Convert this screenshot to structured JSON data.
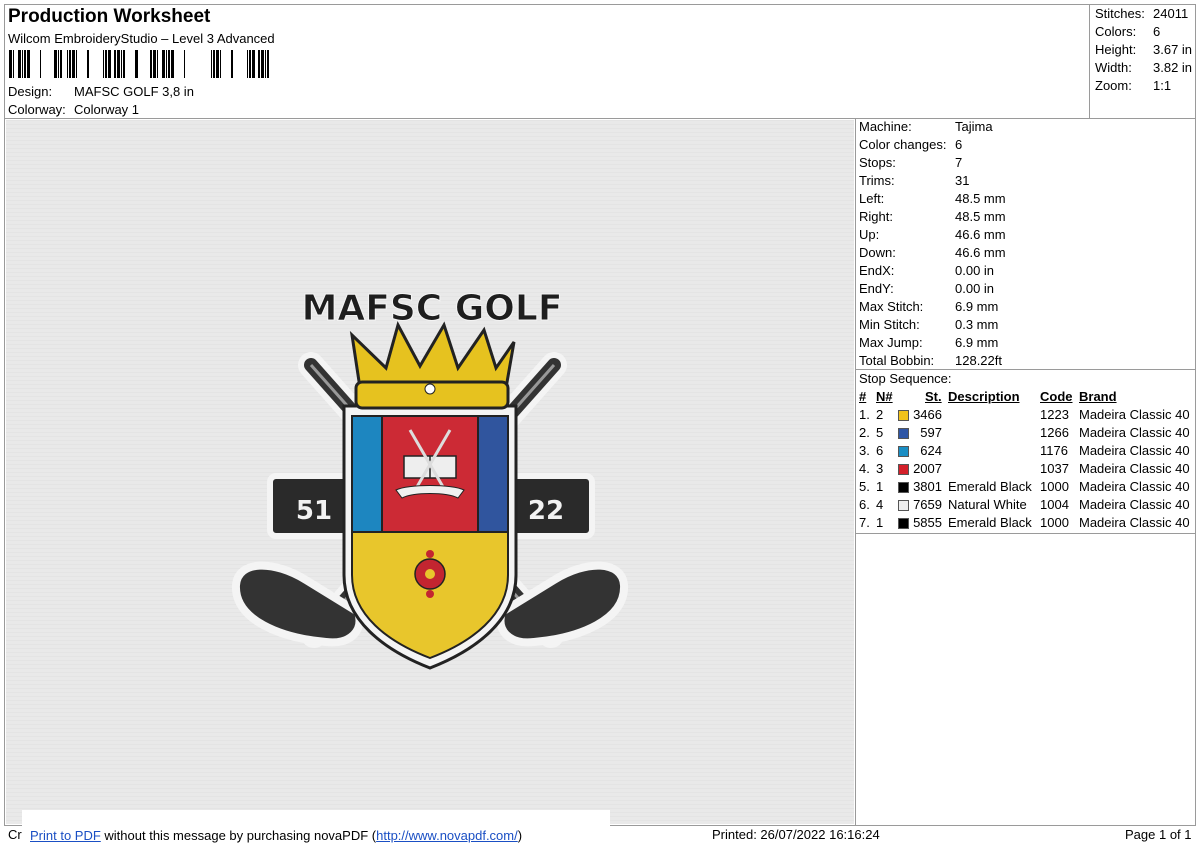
{
  "header": {
    "title": "Production Worksheet",
    "software": "Wilcom EmbroideryStudio – Level 3 Advanced",
    "design_label": "Design:",
    "design_value": "MAFSC GOLF 3,8 in",
    "colorway_label": "Colorway:",
    "colorway_value": "Colorway 1"
  },
  "summary": [
    {
      "label": "Stitches:",
      "value": "24011"
    },
    {
      "label": "Colors:",
      "value": "6"
    },
    {
      "label": "Height:",
      "value": "3.67 in"
    },
    {
      "label": "Width:",
      "value": "3.82 in"
    },
    {
      "label": "Zoom:",
      "value": "1:1"
    }
  ],
  "machine_info": [
    {
      "label": "Machine:",
      "value": "Tajima"
    },
    {
      "label": "Color changes:",
      "value": "6"
    },
    {
      "label": "Stops:",
      "value": "7"
    },
    {
      "label": "Trims:",
      "value": "31"
    },
    {
      "label": "Left:",
      "value": "48.5 mm"
    },
    {
      "label": "Right:",
      "value": "48.5 mm"
    },
    {
      "label": "Up:",
      "value": "46.6 mm"
    },
    {
      "label": "Down:",
      "value": "46.6 mm"
    },
    {
      "label": "EndX:",
      "value": "0.00 in"
    },
    {
      "label": "EndY:",
      "value": "0.00 in"
    },
    {
      "label": "Max Stitch:",
      "value": "6.9 mm"
    },
    {
      "label": "Min Stitch:",
      "value": "0.3 mm"
    },
    {
      "label": "Max Jump:",
      "value": "6.9 mm"
    },
    {
      "label": "Total Bobbin:",
      "value": "128.22ft"
    }
  ],
  "stop_sequence": {
    "title": "Stop Sequence:",
    "headers": {
      "num": "#",
      "n": "N#",
      "st": "St.",
      "desc": "Description",
      "code": "Code",
      "brand": "Brand"
    },
    "rows": [
      {
        "num": "1.",
        "n": "2",
        "color": "#f2c21b",
        "st": "3466",
        "desc": "",
        "code": "1223",
        "brand": "Madeira Classic 40"
      },
      {
        "num": "2.",
        "n": "5",
        "color": "#2f56a6",
        "st": "597",
        "desc": "",
        "code": "1266",
        "brand": "Madeira Classic 40"
      },
      {
        "num": "3.",
        "n": "6",
        "color": "#1a8ec4",
        "st": "624",
        "desc": "",
        "code": "1176",
        "brand": "Madeira Classic 40"
      },
      {
        "num": "4.",
        "n": "3",
        "color": "#d4202a",
        "st": "2007",
        "desc": "",
        "code": "1037",
        "brand": "Madeira Classic 40"
      },
      {
        "num": "5.",
        "n": "1",
        "color": "#000000",
        "st": "3801",
        "desc": "Emerald Black",
        "code": "1000",
        "brand": "Madeira Classic 40"
      },
      {
        "num": "6.",
        "n": "4",
        "color": "#eeeeee",
        "st": "7659",
        "desc": "Natural White",
        "code": "1004",
        "brand": "Madeira Classic 40"
      },
      {
        "num": "7.",
        "n": "1",
        "color": "#000000",
        "st": "5855",
        "desc": "Emerald Black",
        "code": "1000",
        "brand": "Madeira Classic 40"
      }
    ]
  },
  "design": {
    "text_top": "MAFSC GOLF",
    "left_number": "51",
    "right_number": "22"
  },
  "footer": {
    "cut_prefix": "Cr",
    "print_link": "Print to PDF",
    "message": " without this message by purchasing novaPDF (",
    "url": "http://www.novapdf.com/",
    "close": ")",
    "printed": "Printed: 26/07/2022 16:16:24",
    "page": "Page 1 of 1"
  }
}
